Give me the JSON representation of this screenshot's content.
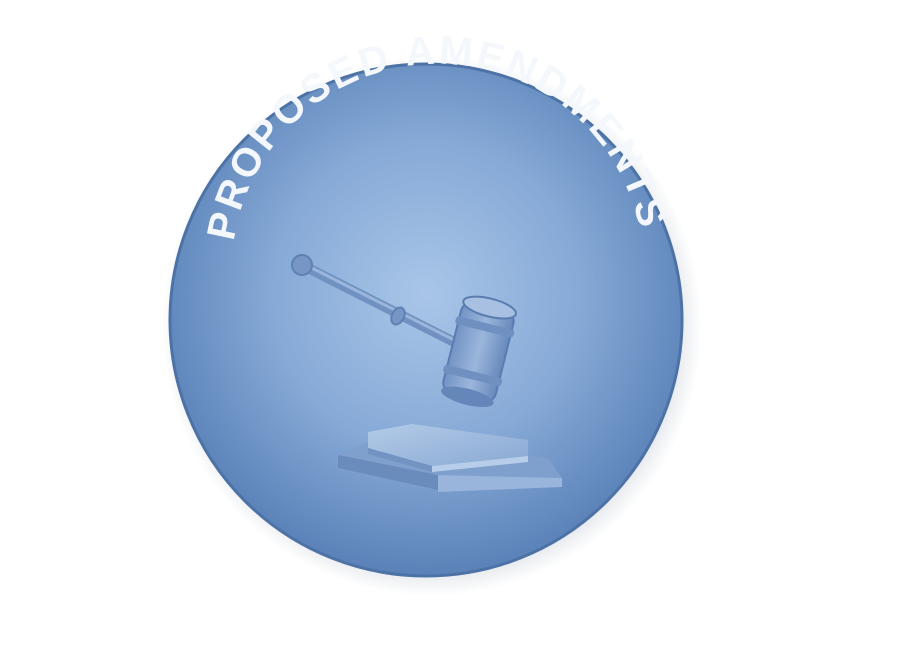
{
  "badge": {
    "title": "PROPOSED AMENDMENTS",
    "icon": "gavel-and-sound-block-icon",
    "colors": {
      "disc_center": "#a6c4e6",
      "disc_edge": "#5a82b8",
      "rim": "#4d72a6",
      "text": "#f4f8fc",
      "icon_dark": "#6d8fbf",
      "icon_light": "#a9c2e3"
    }
  }
}
